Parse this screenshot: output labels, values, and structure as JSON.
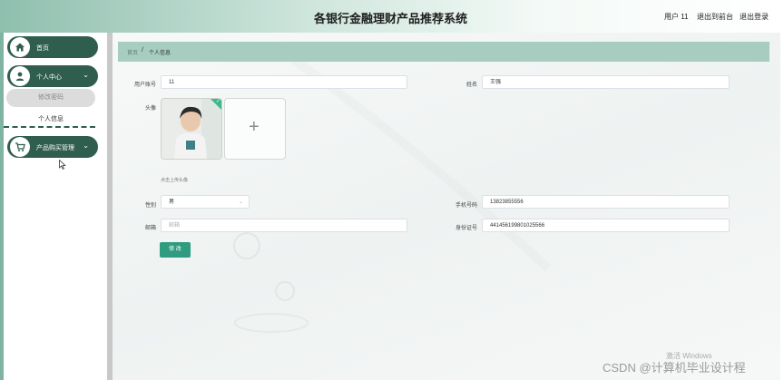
{
  "header": {
    "title": "各银行金融理财产品推荐系统",
    "user": "用户 11",
    "back_front": "退出到前台",
    "logout": "退出登录"
  },
  "sidebar": {
    "items": [
      {
        "label": "首页",
        "icon": "home-icon"
      },
      {
        "label": "个人中心",
        "icon": "user-icon",
        "chevron": "⌄"
      },
      {
        "label": "产品购买管理",
        "icon": "cart-icon",
        "chevron": "⌄"
      }
    ],
    "submenu": [
      {
        "label": "修改密码"
      },
      {
        "label": "个人信息"
      }
    ]
  },
  "breadcrumb": {
    "home": "首页",
    "separator": "/",
    "current": "个人信息"
  },
  "form": {
    "account_label": "用户账号",
    "account_value": "11",
    "name_label": "姓名",
    "name_value": "王强",
    "avatar_label": "头像",
    "upload_plus": "+",
    "upload_hint": "点击上传头像",
    "gender_label": "性别",
    "gender_value": "男",
    "phone_label": "手机号码",
    "phone_value": "13823855556",
    "email_label": "邮箱",
    "email_placeholder": "邮箱",
    "idcard_label": "身份证号",
    "idcard_value": "441456199801025566",
    "submit_label": "修 改"
  },
  "overlay": {
    "windows_watermark": "激活 Windows",
    "csdn": "CSDN @计算机毕业设计程"
  },
  "colors": {
    "accent": "#2f5e4f",
    "button": "#2f9c80",
    "breadcrumb_bg": "#a6cdbf"
  }
}
